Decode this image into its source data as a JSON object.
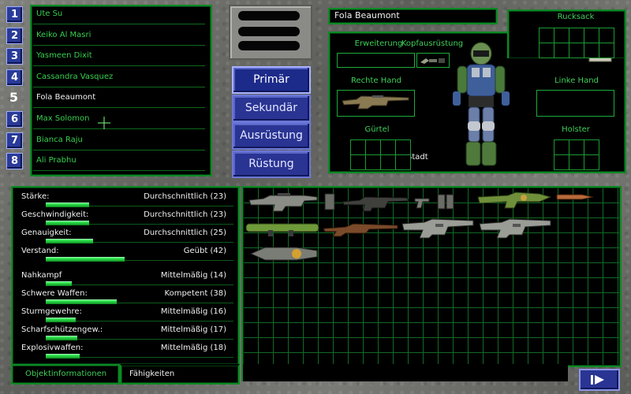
{
  "squad": [
    {
      "num": "1",
      "name": "Ute Su",
      "active": false
    },
    {
      "num": "2",
      "name": "Keiko Al Masri",
      "active": false
    },
    {
      "num": "3",
      "name": "Yasmeen Dixit",
      "active": false
    },
    {
      "num": "4",
      "name": "Cassandra Vasquez",
      "active": false
    },
    {
      "num": "5",
      "name": "Fola Beaumont",
      "active": true
    },
    {
      "num": "6",
      "name": "Max Solomon",
      "active": false
    },
    {
      "num": "7",
      "name": "Bianca Raju",
      "active": false
    },
    {
      "num": "8",
      "name": "Ali Prabhu",
      "active": false
    }
  ],
  "tabs": {
    "primary": "Primär",
    "secondary": "Sekundär",
    "equipment": "Ausrüstung",
    "armor": "Rüstung"
  },
  "character": {
    "name": "Fola Beaumont"
  },
  "slots": {
    "backpack": "Rucksack",
    "extension": "Erweiterung",
    "headgear": "Kopfausrüstung",
    "right_hand": "Rechte Hand",
    "left_hand": "Linke Hand",
    "belt": "Gürtel",
    "holster": "Holster",
    "city_checkbox": "Stadt",
    "city_checked": true
  },
  "stats": [
    {
      "label": "Stärke:",
      "value": "Durchschnittlich (23)",
      "level": 0.23
    },
    {
      "label": "Geschwindigkeit:",
      "value": "Durchschnittlich (23)",
      "level": 0.23
    },
    {
      "label": "Genauigkeit:",
      "value": "Durchschnittlich (25)",
      "level": 0.25
    },
    {
      "label": "Verstand:",
      "value": "Geübt (42)",
      "level": 0.42
    }
  ],
  "skills": [
    {
      "label": "Nahkampf",
      "value": "Mittelmäßig (14)",
      "level": 0.14
    },
    {
      "label": "Schwere Waffen:",
      "value": "Kompetent (38)",
      "level": 0.38
    },
    {
      "label": "Sturmgewehre:",
      "value": "Mittelmäßig (16)",
      "level": 0.16
    },
    {
      "label": "Scharfschützengew.:",
      "value": "Mittelmäßig (17)",
      "level": 0.17
    },
    {
      "label": "Explosivwaffen:",
      "value": "Mittelmäßig (18)",
      "level": 0.18
    }
  ],
  "bottom_tabs": {
    "object_info": "Objektinformationen",
    "skills": "Fähigkeiten"
  },
  "stash_items": [
    "grey-assault-rifle-icon",
    "ammo-clip-icon",
    "dark-rifle-icon",
    "small-pistol-icon",
    "ammo-box-icon",
    "green-launcher-icon",
    "shell-icon",
    "green-rocket-launcher-icon",
    "brown-sniper-rifle-icon",
    "heavy-gun-icon",
    "heavy-gun-icon",
    "flamethrower-icon"
  ],
  "colors": {
    "panel_border": "#0c8a24",
    "label_green": "#3fcf58",
    "tab_blue": "#2a3493"
  }
}
